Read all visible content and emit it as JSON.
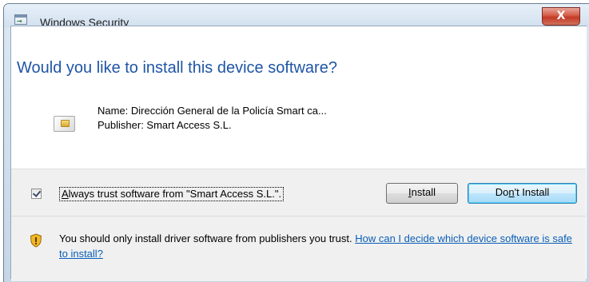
{
  "window": {
    "title": "Windows Security",
    "close_glyph": "X"
  },
  "heading": "Would you like to install this device software?",
  "device": {
    "name_line": "Name: Dirección General de la Policía Smart ca...",
    "publisher_line": "Publisher: Smart Access S.L.",
    "icon": "smart-card-reader-icon"
  },
  "trust_checkbox": {
    "checked": true,
    "label_prefix": "A",
    "label_rest": "lways trust software from \"Smart Access S.L.\"."
  },
  "buttons": {
    "install_u": "I",
    "install_rest": "nstall",
    "dont_pre": "Do",
    "dont_u": "n",
    "dont_rest": "'t Install"
  },
  "warning": {
    "icon": "shield-warning-icon",
    "text": "You should only install driver software from publishers you trust.",
    "link": "How can I decide which device software is safe to install?"
  },
  "colors": {
    "heading": "#1f55a6",
    "link": "#0a5fb8",
    "close": "#c23a26"
  }
}
